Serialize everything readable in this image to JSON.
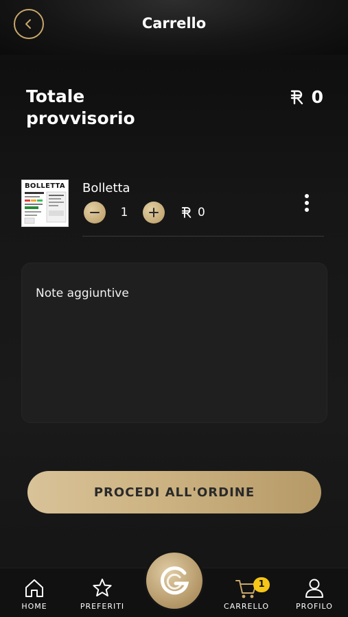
{
  "header": {
    "title": "Carrello",
    "back_icon": "chevron-left-icon",
    "accent_color": "#c9a86a"
  },
  "summary": {
    "label": "Totale provvisorio",
    "amount": "0",
    "currency_icon": "currency-icon"
  },
  "cart": {
    "items": [
      {
        "name": "Bolletta",
        "thumbnail_text": "BOLLETTA",
        "quantity": "1",
        "price": "0"
      }
    ]
  },
  "notes": {
    "placeholder": "Note aggiuntive"
  },
  "actions": {
    "proceed_label": "PROCEDI ALL'ORDINE"
  },
  "nav": {
    "items": [
      {
        "label": "HOME",
        "icon": "home-icon"
      },
      {
        "label": "PREFERITI",
        "icon": "star-icon"
      },
      {
        "label": "CARRELLO",
        "icon": "cart-icon",
        "badge": "1"
      },
      {
        "label": "PROFILO",
        "icon": "user-icon"
      }
    ],
    "center_icon": "brand-logo-icon",
    "badge_color": "#f5c518"
  }
}
